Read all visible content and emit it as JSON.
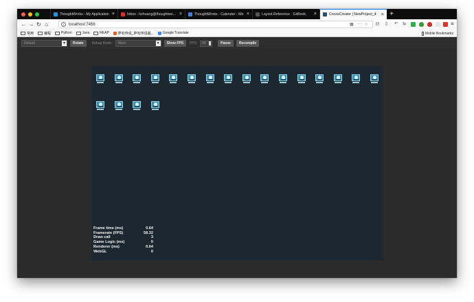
{
  "browser": {
    "tabs": [
      {
        "label": "ThoughtWorks - My Application",
        "color": "#1a9ad9",
        "active": false
      },
      {
        "label": "Inbox - hzhuang@thoughtworks",
        "color": "#d93025",
        "active": false
      },
      {
        "label": "ThoughtWorks - Calendar - We",
        "color": "#4a7bd6",
        "active": false
      },
      {
        "label": "Layout Reference · GitBook",
        "color": "#555555",
        "active": false
      },
      {
        "label": "CocosCreator | NewProject_4",
        "color": "#2b4e66",
        "active": true
      }
    ],
    "new_tab_label": "+",
    "close_label": "×",
    "url": "localhost:7456",
    "info_glyph": "i",
    "url_tools": {
      "qr": "▦",
      "more": "···",
      "star": "☆"
    },
    "nav": {
      "back": "←",
      "forward": "→",
      "reload": "↻",
      "home": "⌂"
    },
    "toolbar_right": {
      "library": "|||\\",
      "sidebar": "▯",
      "back2": "↶",
      "tab2": "⇆"
    },
    "bookmarks": [
      {
        "label": "常用",
        "type": "folder"
      },
      {
        "label": "编程",
        "type": "folder"
      },
      {
        "label": "Python",
        "type": "folder"
      },
      {
        "label": "Java",
        "type": "folder"
      },
      {
        "label": "REAP",
        "type": "folder"
      },
      {
        "label": "萨石传说_萨石传说最...",
        "type": "link",
        "color": "#e06020"
      },
      {
        "label": "Google Translate",
        "type": "link",
        "color": "#4285f4"
      }
    ],
    "mobile_bookmarks": "Mobile Bookmarks",
    "ext_icon_names": [
      "library-icon",
      "sidebar-icon",
      "undo-icon",
      "share-icon"
    ]
  },
  "cocos_toolbar": {
    "device_select": {
      "value": "Default",
      "arrow": "▼"
    },
    "rotate_label": "Rotate",
    "debug_mode_label": "Debug Mode:",
    "debug_select": {
      "value": "Warn",
      "arrow": "▼"
    },
    "show_fps_label": "Show FPS",
    "fps_label": "FPS:",
    "fps_value": "60",
    "pause_label": "Pause",
    "recompile_label": "Recompile"
  },
  "game": {
    "sprite_count_row1": 16,
    "sprite_count_row2": 4,
    "stats": [
      {
        "key": "Frame time (ms)",
        "value": "0.64"
      },
      {
        "key": "Framerate (FPS)",
        "value": "58.32"
      },
      {
        "key": "Draw call",
        "value": "3"
      },
      {
        "key": "Game Logic (ms)",
        "value": "0"
      },
      {
        "key": "Renderer (ms)",
        "value": "0.64"
      },
      {
        "key": "WebGL",
        "value": "0"
      }
    ]
  }
}
